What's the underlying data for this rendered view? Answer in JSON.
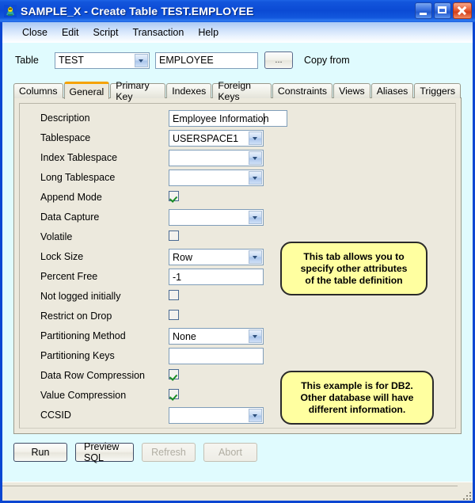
{
  "window": {
    "title": "SAMPLE_X - Create Table TEST.EMPLOYEE",
    "icon": "app-icon",
    "minimize_label": "Minimize",
    "maximize_label": "Maximize",
    "close_label": "Close"
  },
  "menubar": {
    "items": [
      {
        "label": "Close"
      },
      {
        "label": "Edit"
      },
      {
        "label": "Script"
      },
      {
        "label": "Transaction"
      },
      {
        "label": "Help"
      }
    ]
  },
  "table_row": {
    "label": "Table",
    "schema_value": "TEST",
    "schema_placeholder": "",
    "name_value": "EMPLOYEE",
    "name_placeholder": "",
    "browse_label": "...",
    "copy_from_label": "Copy from"
  },
  "tabs": [
    {
      "label": "Columns",
      "active": false
    },
    {
      "label": "General",
      "active": true
    },
    {
      "label": "Primary Key",
      "active": false
    },
    {
      "label": "Indexes",
      "active": false
    },
    {
      "label": "Foreign Keys",
      "active": false
    },
    {
      "label": "Constraints",
      "active": false
    },
    {
      "label": "Views",
      "active": false
    },
    {
      "label": "Aliases",
      "active": false
    },
    {
      "label": "Triggers",
      "active": false
    }
  ],
  "form": {
    "rows": [
      {
        "label": "Description",
        "type": "text",
        "value": "Employee Information",
        "width": "wide",
        "caret": true
      },
      {
        "label": "Tablespace",
        "type": "combo",
        "value": "USERSPACE1",
        "width": "narrow"
      },
      {
        "label": "Index Tablespace",
        "type": "combo",
        "value": "",
        "width": "narrow"
      },
      {
        "label": "Long Tablespace",
        "type": "combo",
        "value": "",
        "width": "narrow"
      },
      {
        "label": "Append Mode",
        "type": "checkbox",
        "checked": true
      },
      {
        "label": "Data Capture",
        "type": "combo",
        "value": "",
        "width": "narrow"
      },
      {
        "label": "Volatile",
        "type": "checkbox",
        "checked": false
      },
      {
        "label": "Lock Size",
        "type": "combo",
        "value": "Row",
        "width": "narrow"
      },
      {
        "label": "Percent Free",
        "type": "text",
        "value": "-1",
        "width": "narrow"
      },
      {
        "label": "Not logged initially",
        "type": "checkbox",
        "checked": false
      },
      {
        "label": "Restrict on Drop",
        "type": "checkbox",
        "checked": false
      },
      {
        "label": "Partitioning Method",
        "type": "combo",
        "value": "None",
        "width": "narrow"
      },
      {
        "label": "Partitioning Keys",
        "type": "text",
        "value": "",
        "width": "narrow"
      },
      {
        "label": "Data Row Compression",
        "type": "checkbox",
        "checked": true
      },
      {
        "label": "Value Compression",
        "type": "checkbox",
        "checked": true
      },
      {
        "label": "CCSID",
        "type": "combo",
        "value": "",
        "width": "narrow"
      }
    ]
  },
  "callouts": [
    {
      "lines": [
        "This tab allows you to",
        "specify other attributes",
        "of the table definition"
      ],
      "color": "#ffffa0"
    },
    {
      "lines": [
        "This example is for DB2.",
        "Other database will have",
        "different information."
      ],
      "color": "#ffffa0"
    }
  ],
  "actions": [
    {
      "label": "Run",
      "disabled": false
    },
    {
      "label": "Preview SQL",
      "disabled": false
    },
    {
      "label": "Refresh",
      "disabled": true
    },
    {
      "label": "Abort",
      "disabled": true
    }
  ],
  "statusbar": {
    "text": ""
  },
  "colors": {
    "titlebar": "#0b4ad4",
    "client_bg": "#e0fbfe",
    "panel_bg": "#ece9dd",
    "active_tab_accent": "#f5a200",
    "callout_bg": "#ffffa0",
    "check_green": "#188c24"
  }
}
